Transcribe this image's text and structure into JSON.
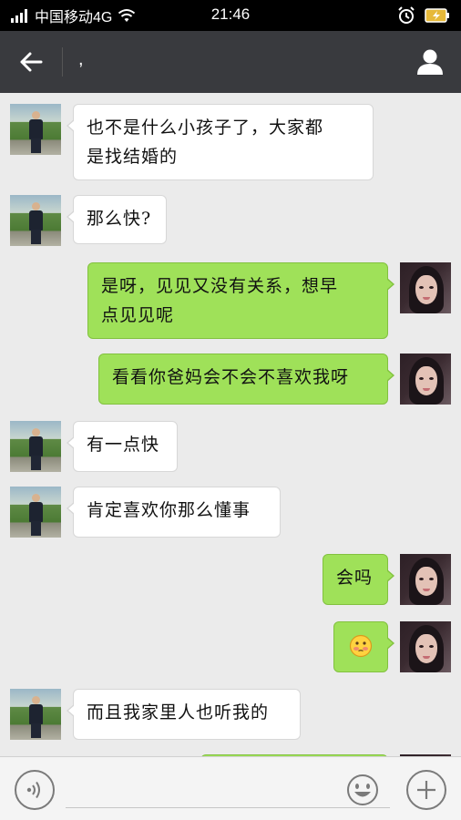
{
  "status_bar": {
    "carrier": "中国移动4G",
    "time": "21:46",
    "icons": [
      "signal-icon",
      "wifi-icon",
      "alarm-icon",
      "battery-charging-icon"
    ]
  },
  "header": {
    "title": ",",
    "back_icon": "arrow-left-icon",
    "profile_icon": "person-icon"
  },
  "colors": {
    "header_bg": "#393a3e",
    "chat_bg": "#ebebeb",
    "outgoing_bubble": "#9fe159",
    "incoming_bubble": "#ffffff"
  },
  "messages": [
    {
      "side": "in",
      "text": "也不是什么小孩子了，大家都\n是找结婚的"
    },
    {
      "side": "in",
      "text": "那么快?"
    },
    {
      "side": "out",
      "text": "是呀，见见又没有关系，想早\n点见见呢"
    },
    {
      "side": "out",
      "text": "看看你爸妈会不会不喜欢我呀"
    },
    {
      "side": "in",
      "text": "有一点快"
    },
    {
      "side": "in",
      "text": "肯定喜欢你那么懂事"
    },
    {
      "side": "out",
      "text": "会吗"
    },
    {
      "side": "out",
      "text": "",
      "emoji": "blushing-face-emoji"
    },
    {
      "side": "in",
      "text": "而且我家里人也听我的"
    }
  ],
  "input_bar": {
    "voice_icon": "voice-icon",
    "emoji_icon": "smiley-icon",
    "plus_icon": "plus-icon",
    "input_value": "",
    "input_placeholder": ""
  }
}
